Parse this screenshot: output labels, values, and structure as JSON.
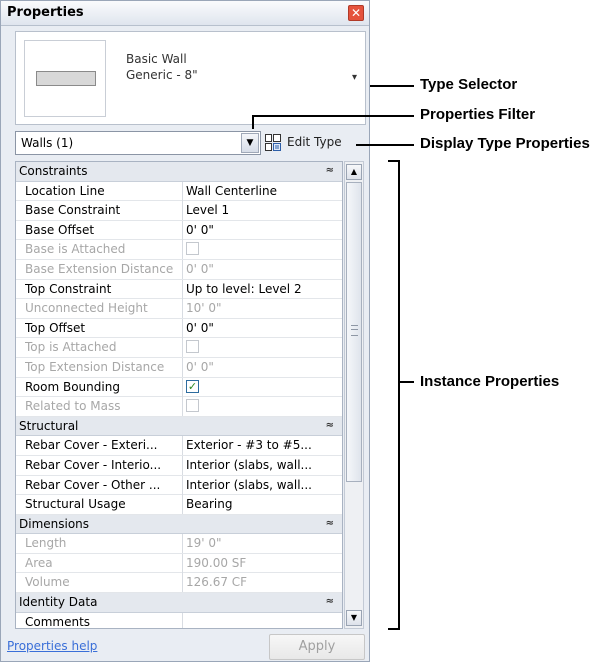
{
  "palette": {
    "title": "Properties",
    "close_glyph": "✕"
  },
  "type_selector": {
    "family": "Basic Wall",
    "type": "Generic - 8\"",
    "dropdown_glyph": "▾"
  },
  "filter": {
    "value": "Walls (1)",
    "dropdown_glyph": "▼"
  },
  "edit_type": {
    "label": "Edit Type",
    "icon": "edit-type-icon"
  },
  "grid": {
    "rows": [
      {
        "kind": "category",
        "label": "Constraints",
        "chevron": "≈"
      },
      {
        "label": "Location Line",
        "value": "Wall Centerline"
      },
      {
        "label": "Base Constraint",
        "value": "Level 1"
      },
      {
        "label": "Base Offset",
        "value": "0'  0\""
      },
      {
        "label": "Base is Attached",
        "checkbox": false,
        "disabled": true
      },
      {
        "label": "Base Extension Distance",
        "value": "0'  0\"",
        "disabled": true
      },
      {
        "label": "Top Constraint",
        "value": "Up to level: Level 2"
      },
      {
        "label": "Unconnected Height",
        "value": "10'  0\"",
        "disabled": true
      },
      {
        "label": "Top Offset",
        "value": "0'  0\""
      },
      {
        "label": "Top is Attached",
        "checkbox": false,
        "disabled": true
      },
      {
        "label": "Top Extension Distance",
        "value": "0'  0\"",
        "disabled": true
      },
      {
        "label": "Room Bounding",
        "checkbox": true
      },
      {
        "label": "Related to Mass",
        "checkbox": false,
        "disabled": true
      },
      {
        "kind": "category",
        "label": "Structural",
        "chevron": "≈"
      },
      {
        "label": "Rebar Cover - Exteri...",
        "value": "Exterior - #3 to #5..."
      },
      {
        "label": "Rebar Cover - Interio...",
        "value": "Interior (slabs, wall..."
      },
      {
        "label": "Rebar Cover - Other ...",
        "value": "Interior (slabs, wall..."
      },
      {
        "label": "Structural Usage",
        "value": "Bearing"
      },
      {
        "kind": "category",
        "label": "Dimensions",
        "chevron": "≈"
      },
      {
        "label": "Length",
        "value": "19'  0\"",
        "disabled": true
      },
      {
        "label": "Area",
        "value": "190.00 SF",
        "disabled": true
      },
      {
        "label": "Volume",
        "value": "126.67 CF",
        "disabled": true
      },
      {
        "kind": "category",
        "label": "Identity Data",
        "chevron": "≈"
      },
      {
        "label": "Comments",
        "value": ""
      }
    ]
  },
  "scrollbar": {
    "up_glyph": "▲",
    "down_glyph": "▼"
  },
  "footer": {
    "help_label": "Properties help",
    "apply_label": "Apply"
  },
  "annotations": {
    "type_selector": "Type Selector",
    "properties_filter": "Properties Filter",
    "display_type_properties": "Display Type Properties",
    "instance_properties": "Instance Properties"
  }
}
